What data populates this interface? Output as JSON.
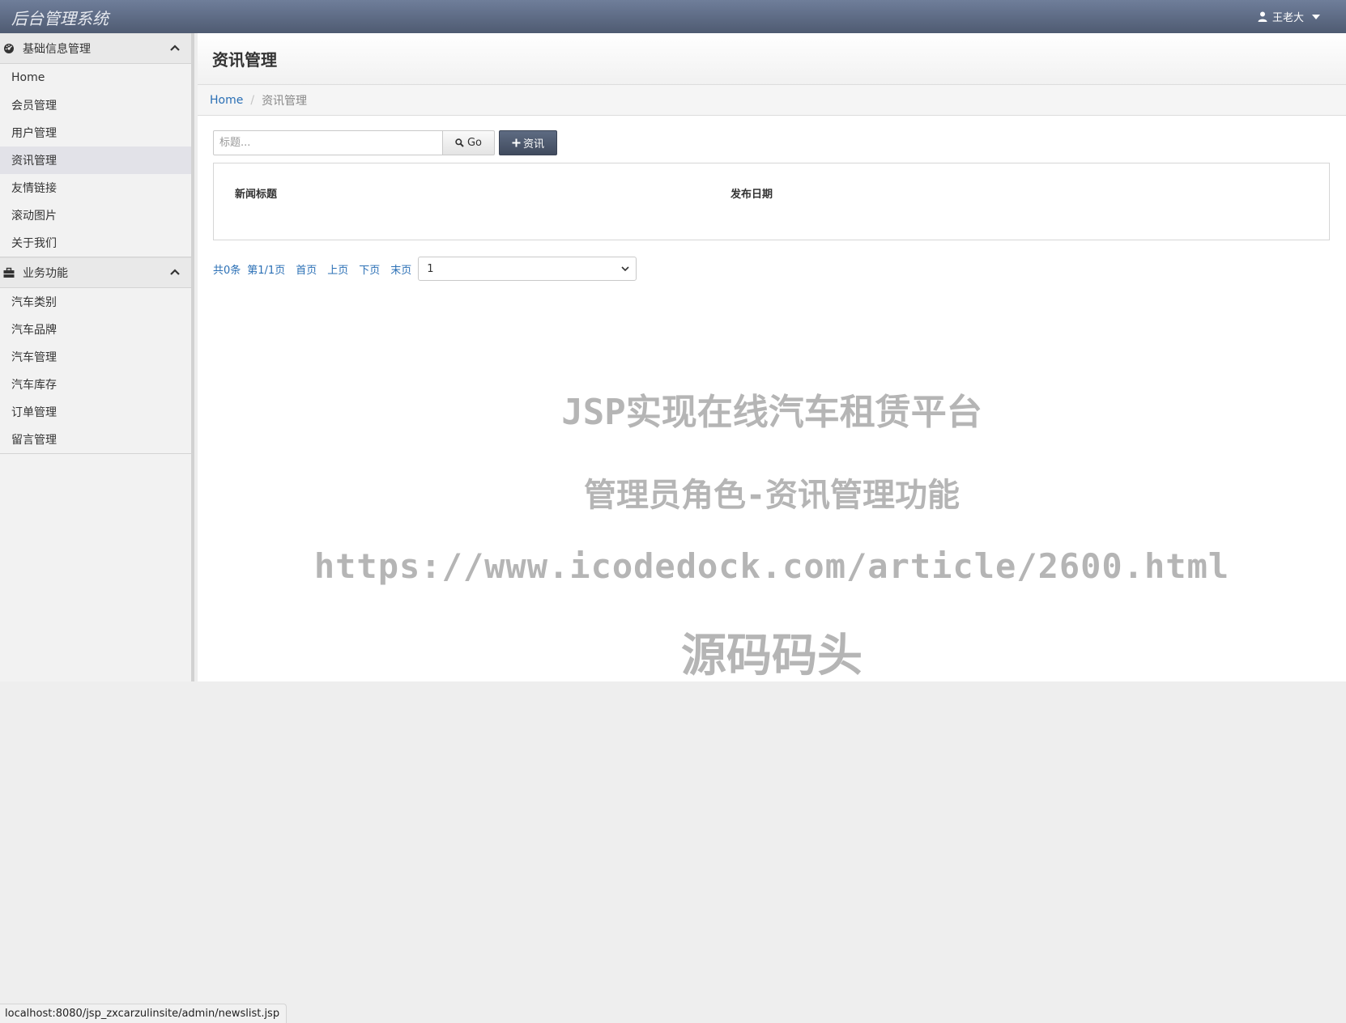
{
  "header": {
    "brand": "后台管理系统",
    "user_name": "王老大"
  },
  "sidebar": {
    "groups": [
      {
        "title": "基础信息管理",
        "items": [
          "Home",
          "会员管理",
          "用户管理",
          "资讯管理",
          "友情链接",
          "滚动图片",
          "关于我们"
        ]
      },
      {
        "title": "业务功能",
        "items": [
          "汽车类别",
          "汽车品牌",
          "汽车管理",
          "汽车库存",
          "订单管理",
          "留言管理"
        ]
      }
    ],
    "active_item": "资讯管理"
  },
  "main": {
    "page_title": "资讯管理",
    "breadcrumb": {
      "home": "Home",
      "separator": "/",
      "current": "资讯管理"
    },
    "search": {
      "placeholder": "标题...",
      "go_label": "Go",
      "add_label": "资讯"
    },
    "table": {
      "columns": [
        "新闻标题",
        "发布日期"
      ],
      "rows": []
    },
    "pager": {
      "total": "共0条",
      "page_info": "第1/1页",
      "first": "首页",
      "prev": "上页",
      "next": "下页",
      "last": "末页",
      "selected_page": "1"
    }
  },
  "watermark": {
    "line1": "JSP实现在线汽车租赁平台",
    "line2": "管理员角色-资讯管理功能",
    "line3": "https://www.icodedock.com/article/2600.html",
    "line4": "源码码头"
  },
  "statusbar": {
    "url": "localhost:8080/jsp_zxcarzulinsite/admin/newslist.jsp"
  },
  "icons": {
    "user": "user-icon",
    "dashboard": "dashboard-icon",
    "briefcase": "briefcase-icon",
    "chevron_up": "chevron-up-icon",
    "search": "search-icon",
    "plus": "plus-icon"
  },
  "colors": {
    "navbar": "#5f6c85",
    "link": "#2a6fb5",
    "primary_button": "#4b556a",
    "active_item": "#e2e2e8"
  }
}
